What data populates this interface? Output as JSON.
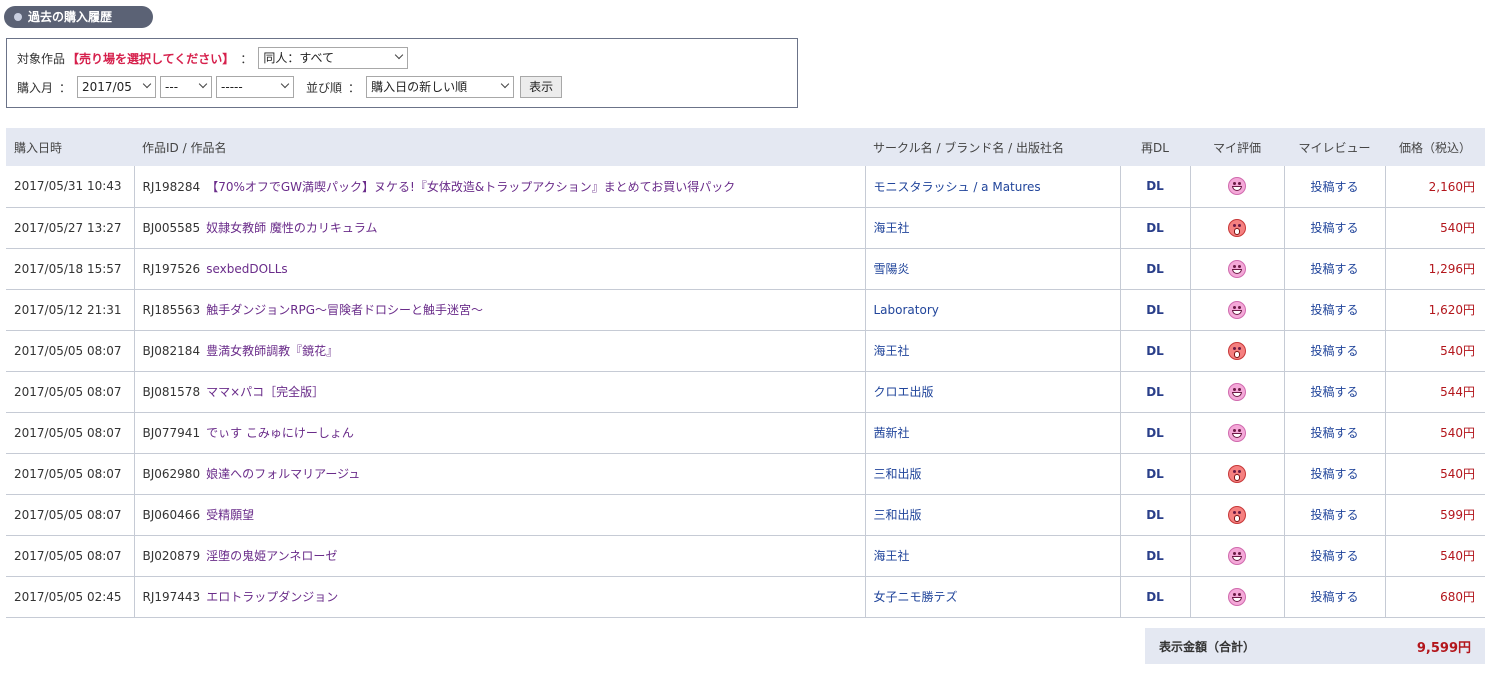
{
  "section": {
    "title": "過去の購入履歴"
  },
  "filters": {
    "target_label": "対象作品",
    "warning": "【売り場を選択してください】",
    "colon": "：",
    "category_value": "同人：すべて",
    "month_label": "購入月",
    "year_month_value": "2017/05",
    "day_value": "---",
    "time_value": "-----",
    "sort_label": "並び順",
    "sort_value": "購入日の新しい順",
    "show_button": "表示"
  },
  "table": {
    "headers": {
      "date": "購入日時",
      "product": "作品ID / 作品名",
      "circle": "サークル名 / ブランド名 / 出版社名",
      "redl": "再DL",
      "rating": "マイ評価",
      "review": "マイレビュー",
      "price": "価格（税込）"
    },
    "rows": [
      {
        "date": "2017/05/31 10:43",
        "id": "RJ198284",
        "name": "【70%オフでGW満喫パック】ヌケる!『女体改造&トラップアクション』まとめてお買い得パック",
        "circle": "モニスタラッシュ / a Matures",
        "dl": "DL",
        "rating": "smile-face",
        "review": "投稿する",
        "price": "2,160円"
      },
      {
        "date": "2017/05/27 13:27",
        "id": "BJ005585",
        "name": "奴隷女教師 魔性のカリキュラム",
        "circle": "海王社",
        "dl": "DL",
        "rating": "surprised-face",
        "review": "投稿する",
        "price": "540円"
      },
      {
        "date": "2017/05/18 15:57",
        "id": "RJ197526",
        "name": "sexbedDOLLs",
        "circle": "雪陽炎",
        "dl": "DL",
        "rating": "smile-face",
        "review": "投稿する",
        "price": "1,296円"
      },
      {
        "date": "2017/05/12 21:31",
        "id": "RJ185563",
        "name": "触手ダンジョンRPG～冒険者ドロシーと触手迷宮～",
        "circle": "Laboratory",
        "dl": "DL",
        "rating": "smile-face",
        "review": "投稿する",
        "price": "1,620円"
      },
      {
        "date": "2017/05/05 08:07",
        "id": "BJ082184",
        "name": "豊満女教師調教『鏡花』",
        "circle": "海王社",
        "dl": "DL",
        "rating": "surprised-face",
        "review": "投稿する",
        "price": "540円"
      },
      {
        "date": "2017/05/05 08:07",
        "id": "BJ081578",
        "name": "ママ×パコ［完全版］",
        "circle": "クロエ出版",
        "dl": "DL",
        "rating": "smile-face",
        "review": "投稿する",
        "price": "544円"
      },
      {
        "date": "2017/05/05 08:07",
        "id": "BJ077941",
        "name": "でぃす こみゅにけーしょん",
        "circle": "茜新社",
        "dl": "DL",
        "rating": "smile-face",
        "review": "投稿する",
        "price": "540円"
      },
      {
        "date": "2017/05/05 08:07",
        "id": "BJ062980",
        "name": "娘達へのフォルマリアージュ",
        "circle": "三和出版",
        "dl": "DL",
        "rating": "surprised-face",
        "review": "投稿する",
        "price": "540円"
      },
      {
        "date": "2017/05/05 08:07",
        "id": "BJ060466",
        "name": "受精願望",
        "circle": "三和出版",
        "dl": "DL",
        "rating": "surprised-face",
        "review": "投稿する",
        "price": "599円"
      },
      {
        "date": "2017/05/05 08:07",
        "id": "BJ020879",
        "name": "淫堕の鬼姫アンネローゼ",
        "circle": "海王社",
        "dl": "DL",
        "rating": "smile-face",
        "review": "投稿する",
        "price": "540円"
      },
      {
        "date": "2017/05/05 02:45",
        "id": "RJ197443",
        "name": "エロトラップダンジョン",
        "circle": "女子ニモ勝テズ",
        "dl": "DL",
        "rating": "smile-face",
        "review": "投稿する",
        "price": "680円"
      }
    ]
  },
  "total": {
    "label": "表示金額（合計）",
    "value": "9,599円"
  }
}
